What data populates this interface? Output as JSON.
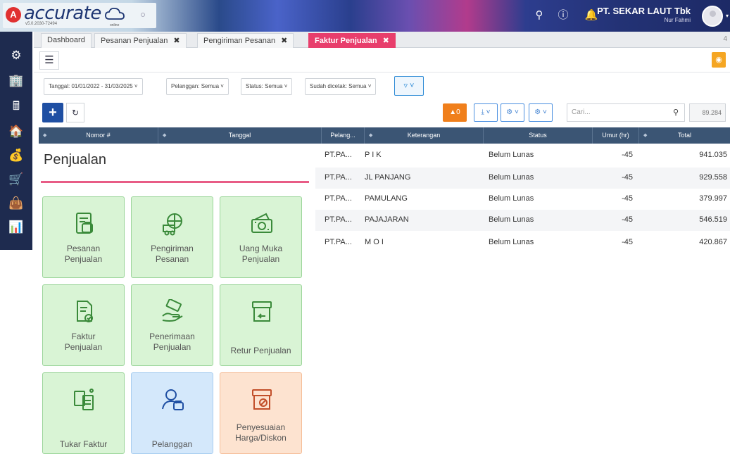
{
  "app": {
    "logo_letter": "A",
    "logo_text": "accurate",
    "logo_sub": "v5.0.2030-72494",
    "logo_cloud_text": "online"
  },
  "user": {
    "company": "PT. SEKAR LAUT Tbk",
    "name": "Nur Fahmi"
  },
  "top_icons": [
    "search-icon",
    "help-icon",
    "bell-icon"
  ],
  "sidebar_icons": [
    "gear-icon",
    "building-icon",
    "calculator-icon",
    "pig-icon",
    "wallet-icon",
    "cart-icon",
    "basket-icon",
    "report-icon"
  ],
  "tabs": [
    {
      "label": "Dashboard",
      "closable": false
    },
    {
      "label": "Pesanan Penjualan",
      "closable": true
    },
    {
      "label": "Pengiriman Pesanan",
      "closable": true
    },
    {
      "label": "Faktur Penjualan",
      "closable": true,
      "active": true
    }
  ],
  "tab_count": "4",
  "filters": [
    "Tanggal: 01/01/2022 - 31/03/2025",
    "Pelanggan: Semua",
    "Status: Semua",
    "Sudah dicetak: Semua"
  ],
  "toolbar": {
    "orange_badge": "0",
    "search_placeholder": "Cari...",
    "total_count": "89.284"
  },
  "table": {
    "columns": [
      "Nomor #",
      "Tanggal",
      "Pelang...",
      "Keterangan",
      "Status",
      "Umur (hr)",
      "Total"
    ],
    "rows": [
      {
        "pelanggan": "PT.PA...",
        "keterangan": "P I K",
        "status": "Belum Lunas",
        "umur": "-45",
        "total": "941.035"
      },
      {
        "pelanggan": "PT.PA...",
        "keterangan": "JL PANJANG",
        "status": "Belum Lunas",
        "umur": "-45",
        "total": "929.558"
      },
      {
        "pelanggan": "PT.PA...",
        "keterangan": "PAMULANG",
        "status": "Belum Lunas",
        "umur": "-45",
        "total": "379.997"
      },
      {
        "pelanggan": "PT.PA...",
        "keterangan": "PAJAJARAN",
        "status": "Belum Lunas",
        "umur": "-45",
        "total": "546.519"
      },
      {
        "pelanggan": "PT.PA...",
        "keterangan": "M O I",
        "status": "Belum Lunas",
        "umur": "-45",
        "total": "420.867"
      }
    ]
  },
  "panel": {
    "title": "Penjualan",
    "tiles": [
      {
        "label1": "Pesanan",
        "label2": "Penjualan",
        "icon": "order-doc-icon"
      },
      {
        "label1": "Pengiriman",
        "label2": "Pesanan",
        "icon": "delivery-truck-icon"
      },
      {
        "label1": "Uang Muka",
        "label2": "Penjualan",
        "icon": "cash-icon"
      },
      {
        "label1": "Faktur",
        "label2": "Penjualan",
        "icon": "invoice-icon"
      },
      {
        "label1": "Penerimaan",
        "label2": "Penjualan",
        "icon": "hand-money-icon"
      },
      {
        "label1": "Retur Penjualan",
        "label2": "",
        "icon": "return-box-icon"
      },
      {
        "label1": "Tukar Faktur",
        "label2": "",
        "icon": "exchange-doc-icon"
      },
      {
        "label1": "Pelanggan",
        "label2": "",
        "icon": "customer-icon"
      },
      {
        "label1": "Penyesuaian",
        "label2": "Harga/Diskon",
        "icon": "price-adjust-icon"
      }
    ]
  }
}
